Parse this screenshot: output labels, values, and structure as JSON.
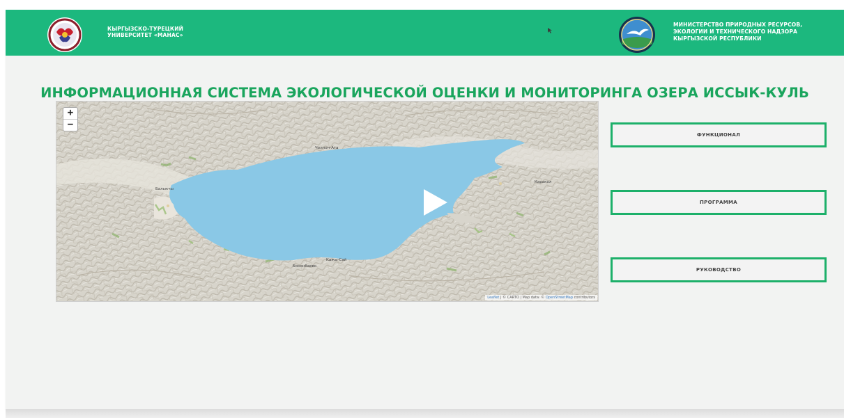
{
  "header": {
    "university_line1": "КЫРГЫЗСКО-ТУРЕЦКИЙ",
    "university_line2": "УНИВЕРСИТЕТ «МАНАС»",
    "ministry_line1": "МИНИСТЕРСТВО ПРИРОДНЫХ РЕСУРСОВ,",
    "ministry_line2": "ЭКОЛОГИИ И ТЕХНИЧЕСКОГО НАДЗОРА",
    "ministry_line3": "КЫРГЫЗСКОЙ РЕСПУБЛИКИ",
    "background_color": "#1cb87e"
  },
  "page_title": "ИНФОРМАЦИОННАЯ СИСТЕМА ЭКОЛОГИЧЕСКОЙ ОЦЕНКИ И МОНИТОРИНГА ОЗЕРА ИССЫК-КУЛЬ",
  "map": {
    "zoom_in_label": "+",
    "zoom_out_label": "−",
    "attribution_leaflet": "Leaflet",
    "attribution_mid": "| © CARTO | Map data: ©",
    "attribution_osm": "OpenStreetMap",
    "attribution_end": "contributors",
    "city_balykchy": "Балыкчы",
    "city_karakol": "Каракол",
    "city_bokonbaevo": "Боконбаево",
    "city_kadzhi_say": "Кажы-Сай",
    "city_cholpon_ata": "Чолпон-Ата",
    "lake_color": "#8ac8e6",
    "icons": [
      "zoom-in-icon",
      "zoom-out-icon",
      "play-icon"
    ]
  },
  "buttons": {
    "functional": "ФУНКЦИОНАЛ",
    "program": "ПРОГРАММА",
    "manual": "РУКОВОДСТВО",
    "border_color": "#1db06a"
  },
  "accent_color": "#1aa55d"
}
